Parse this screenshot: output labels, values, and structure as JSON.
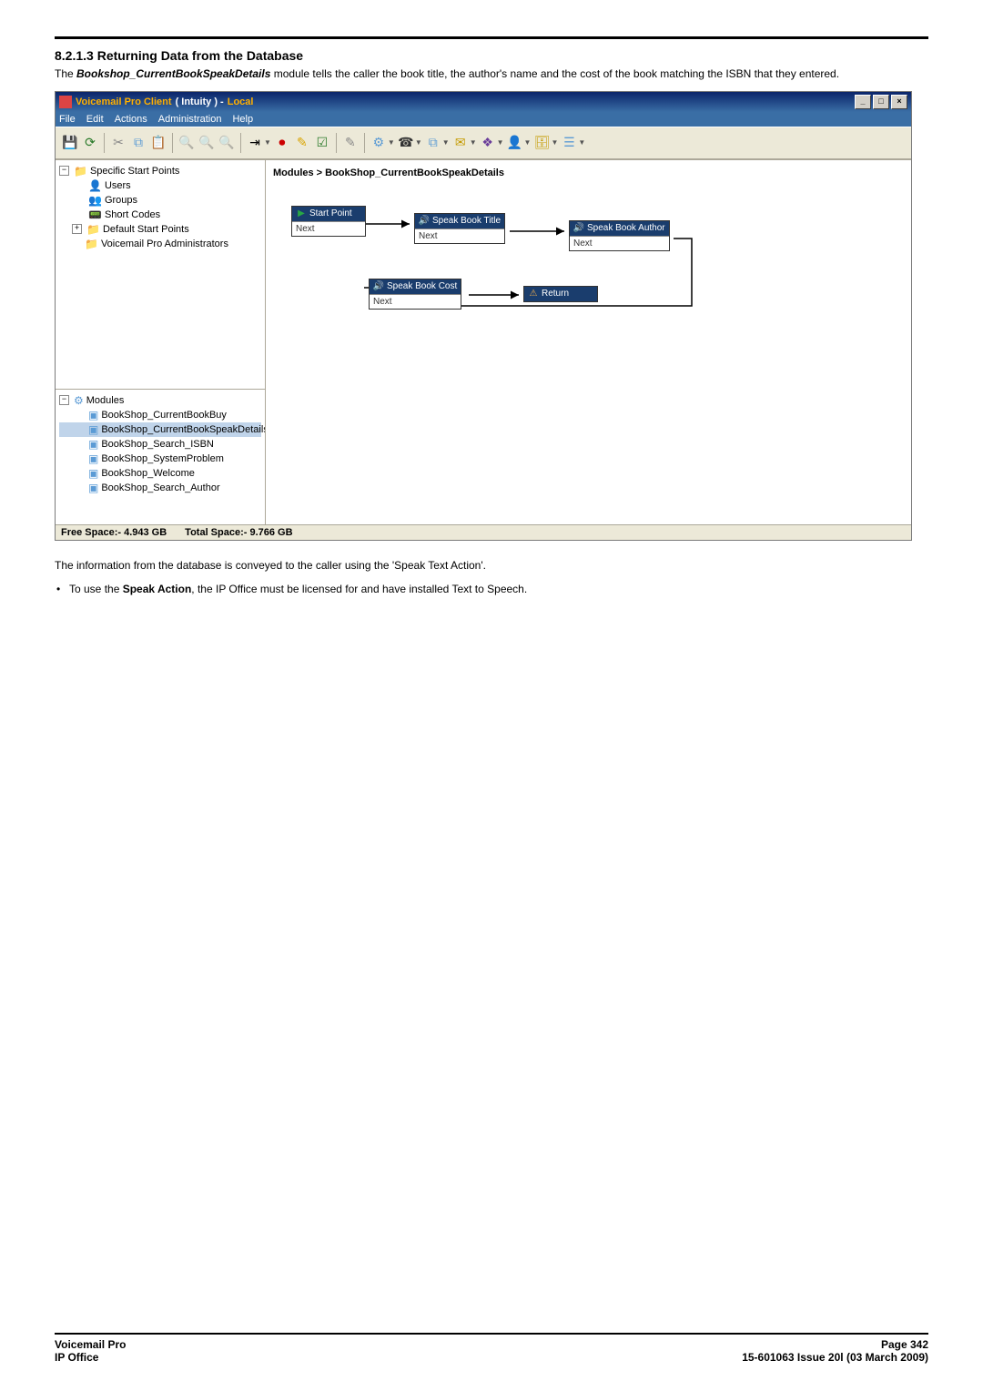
{
  "section": {
    "heading": "8.2.1.3 Returning Data from the Database",
    "intro_pre": "The ",
    "intro_module": "Bookshop_CurrentBookSpeakDetails",
    "intro_post": " module tells the caller the book title, the author's name and the cost of the book matching the ISBN that they entered."
  },
  "app": {
    "title_prefix": "Voicemail Pro Client",
    "title_mid": "( Intuity ) -",
    "title_suffix": "Local",
    "menu": [
      "File",
      "Edit",
      "Actions",
      "Administration",
      "Help"
    ],
    "tree": {
      "root": "Specific Start Points",
      "children": [
        "Users",
        "Groups",
        "Short Codes"
      ],
      "siblings": [
        "Default Start Points",
        "Voicemail Pro Administrators"
      ]
    },
    "modules_root": "Modules",
    "modules": [
      "BookShop_CurrentBookBuy",
      "BookShop_CurrentBookSpeakDetails",
      "BookShop_Search_ISBN",
      "BookShop_SystemProblem",
      "BookShop_Welcome",
      "BookShop_Search_Author"
    ],
    "breadcrumb": "Modules > BookShop_CurrentBookSpeakDetails",
    "nodes": {
      "start": {
        "title": "Start Point",
        "sub": "Next"
      },
      "title_node": {
        "title": "Speak Book Title",
        "sub": "Next"
      },
      "author_node": {
        "title": "Speak Book Author",
        "sub": "Next"
      },
      "cost_node": {
        "title": "Speak Book Cost",
        "sub": "Next"
      },
      "return_node": {
        "title": "Return"
      }
    },
    "status": {
      "free": "Free Space:- 4.943 GB",
      "total": "Total Space:- 9.766 GB"
    }
  },
  "post": {
    "line1": "The information from the database is conveyed to the caller using the 'Speak Text Action'.",
    "bullet_pre": "To use the ",
    "bullet_bold": "Speak Action",
    "bullet_post": ", the IP Office must be licensed for and have installed Text to Speech."
  },
  "footer": {
    "left1": "Voicemail Pro",
    "left2": "IP Office",
    "right1": "Page 342",
    "right2": "15-601063 Issue 20l (03 March 2009)"
  }
}
